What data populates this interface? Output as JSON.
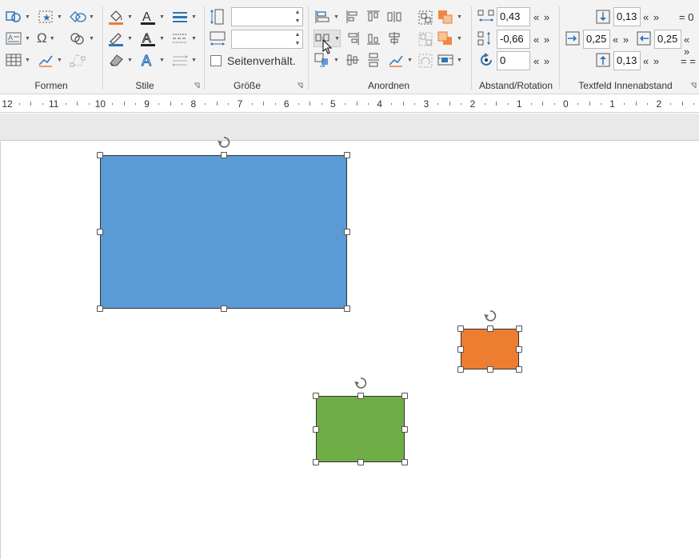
{
  "ribbon": {
    "groups": {
      "formen": "Formen",
      "stile": "Stile",
      "groesse": "Größe",
      "anordnen": "Anordnen",
      "abstand": "Abstand/Rotation",
      "innenabstand": "Textfeld Innenabstand"
    },
    "groesse": {
      "height_value": "",
      "width_value": "",
      "aspect_label": "Seitenverhält."
    },
    "abstand": {
      "horizontal": "0,43",
      "vertical": "-0,66",
      "rotation": "0",
      "step_arrows": "« »"
    },
    "innenabstand": {
      "top": "0,13",
      "left": "0,25",
      "right": "0,25",
      "bottom": "0,13",
      "step_arrows": "« »",
      "eq_top": "= 0",
      "eq_bottom": "= ="
    }
  },
  "ruler": {
    "numbers": [
      "12",
      "11",
      "10",
      "9",
      "8",
      "7",
      "6",
      "5",
      "4",
      "3",
      "2",
      "1",
      "0",
      "1",
      "2"
    ]
  },
  "colors": {
    "blue": "#5b9bd5",
    "orange": "#ed7d31",
    "green": "#70ad47",
    "accent_blue": "#2e75b6",
    "accent_orange": "#ed7d31"
  },
  "icons": [
    "shapes-icon",
    "text-box-icon",
    "table-icon",
    "smart-shape-icon",
    "omega-icon",
    "edit-points-icon",
    "merge-shapes-icon",
    "group-icon",
    "fill-bucket-icon",
    "font-color-icon",
    "line-weight-icon",
    "pen-outline-icon",
    "line-style-icon",
    "eraser-icon",
    "text-effects-icon",
    "arrow-style-icon",
    "align-icon",
    "distribute-icon",
    "rotate-icon",
    "mouse-cursor-icon"
  ]
}
